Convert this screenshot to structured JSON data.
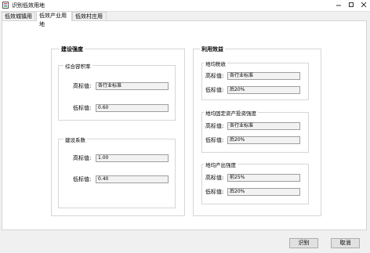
{
  "window": {
    "title": "识别低效用地"
  },
  "tabs": [
    {
      "label": "低效城镇用地"
    },
    {
      "label": "低效产业用地"
    },
    {
      "label": "低效村庄用地"
    }
  ],
  "left": {
    "title": "建设强度",
    "ratio": {
      "title": "综合容积率",
      "high_label": "高标值:",
      "high_value": "各行业标准",
      "low_label": "低标值:",
      "low_value": "0.60"
    },
    "coef": {
      "title": "建设系数",
      "high_label": "高标值:",
      "high_value": "1.00",
      "low_label": "低标值:",
      "low_value": "0.40"
    }
  },
  "right": {
    "title": "利用效益",
    "tax": {
      "title": "地均税收",
      "high_label": "高标值:",
      "high_value": "各行业标准",
      "low_label": "低标值:",
      "low_value": "后20%"
    },
    "invest": {
      "title": "地均固定资产投资强度",
      "high_label": "高标值:",
      "high_value": "各行业标准",
      "low_label": "低标值:",
      "low_value": "后20%"
    },
    "output": {
      "title": "地均产出强度",
      "high_label": "高标值:",
      "high_value": "前25%",
      "low_label": "低标值:",
      "low_value": "后20%"
    }
  },
  "buttons": {
    "identify": "识别",
    "cancel": "取消"
  }
}
